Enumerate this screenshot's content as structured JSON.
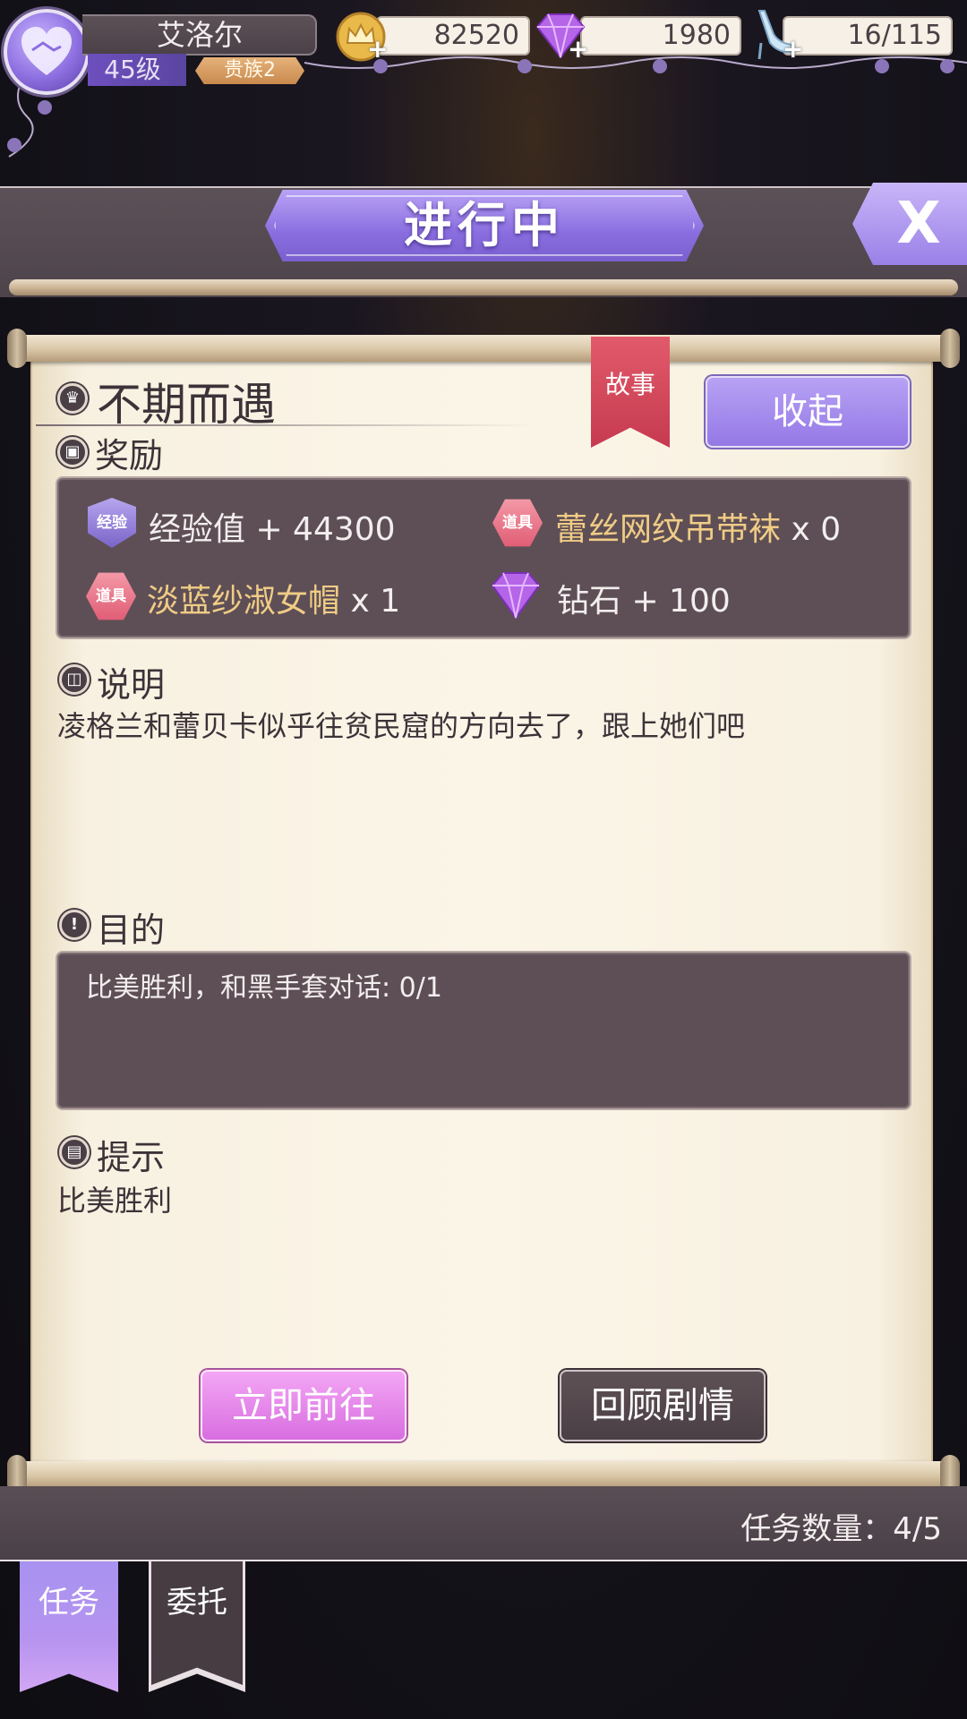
{
  "player": {
    "name": "艾洛尔",
    "level": "45级",
    "noble": "贵族2"
  },
  "resources": {
    "gold": "82520",
    "diamond": "1980",
    "stamina": "16/115"
  },
  "header": {
    "title": "进行中",
    "close_label": "X"
  },
  "quest": {
    "title": "不期而遇",
    "tag": "故事",
    "collapse_label": "收起",
    "rewards_title": "奖励",
    "rewards": {
      "exp_badge": "经验",
      "exp_text": "经验值 + 44300",
      "item1_badge": "道具",
      "item1_name": "蕾丝网纹吊带袜",
      "item1_qty": " x 0",
      "item2_badge": "道具",
      "item2_name": "淡蓝纱淑女帽",
      "item2_qty": " x 1",
      "diamond_text": "钻石 + 100"
    },
    "description_title": "说明",
    "description": "凌格兰和蕾贝卡似乎往贫民窟的方向去了，跟上她们吧",
    "objective_title": "目的",
    "objective": "比美胜利，和黑手套对话: 0/1",
    "hint_title": "提示",
    "hint": "比美胜利",
    "go_label": "立即前往",
    "review_label": "回顾剧情"
  },
  "footer": {
    "task_count": "任务数量：4/5"
  },
  "tabs": {
    "task": "任务",
    "entrust": "委托"
  },
  "colors": {
    "accent_purple": "#9478e6",
    "accent_pink": "#d86ee0",
    "panel_dark": "#5e4f56",
    "paper": "#fbf5e8",
    "ribbon_red": "#c63a4f",
    "gold_text": "#f0cc86"
  }
}
